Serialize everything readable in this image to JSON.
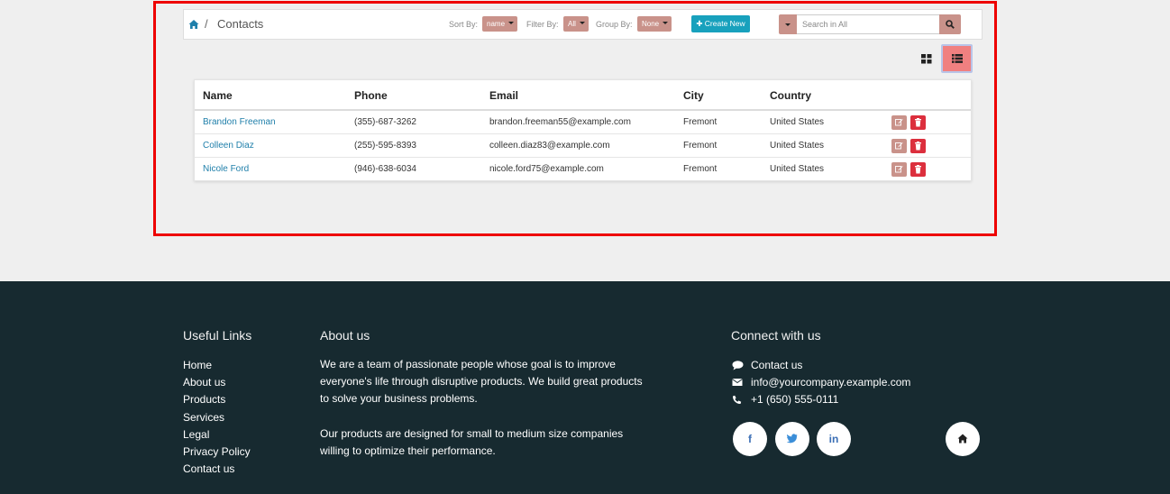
{
  "breadcrumb": {
    "separator": "/",
    "current": "Contacts"
  },
  "controls": {
    "sort_label": "Sort By:",
    "sort_value": "name",
    "filter_label": "Filter By:",
    "filter_value": "All",
    "group_label": "Group By:",
    "group_value": "None",
    "create_label": "✚ Create New",
    "search_placeholder": "Search in All"
  },
  "table": {
    "headers": [
      "Name",
      "Phone",
      "Email",
      "City",
      "Country"
    ],
    "rows": [
      {
        "name": "Brandon Freeman",
        "phone": "(355)-687-3262",
        "email": "brandon.freeman55@example.com",
        "city": "Fremont",
        "country": "United States"
      },
      {
        "name": "Colleen Diaz",
        "phone": "(255)-595-8393",
        "email": "colleen.diaz83@example.com",
        "city": "Fremont",
        "country": "United States"
      },
      {
        "name": "Nicole Ford",
        "phone": "(946)-638-6034",
        "email": "nicole.ford75@example.com",
        "city": "Fremont",
        "country": "United States"
      }
    ]
  },
  "footer": {
    "useful_links_title": "Useful Links",
    "links": [
      "Home",
      "About us",
      "Products",
      "Services",
      "Legal",
      "Privacy Policy",
      "Contact us"
    ],
    "about_title": "About us",
    "about_p1": "We are a team of passionate people whose goal is to improve everyone's life through disruptive products. We build great products to solve your business problems.",
    "about_p2": "Our products are designed for small to medium size companies willing to optimize their performance.",
    "connect_title": "Connect with us",
    "contact_us": "Contact us",
    "email": "info@yourcompany.example.com",
    "phone": "+1 (650) 555-0111",
    "social_facebook": "f",
    "social_linkedin": "in"
  },
  "colors": {
    "accent": "#c9928a",
    "create": "#18a1bd",
    "delete": "#dc2f3d",
    "link": "#1f7faa",
    "footer_bg": "#172a30",
    "highlight": "#ee0000"
  }
}
